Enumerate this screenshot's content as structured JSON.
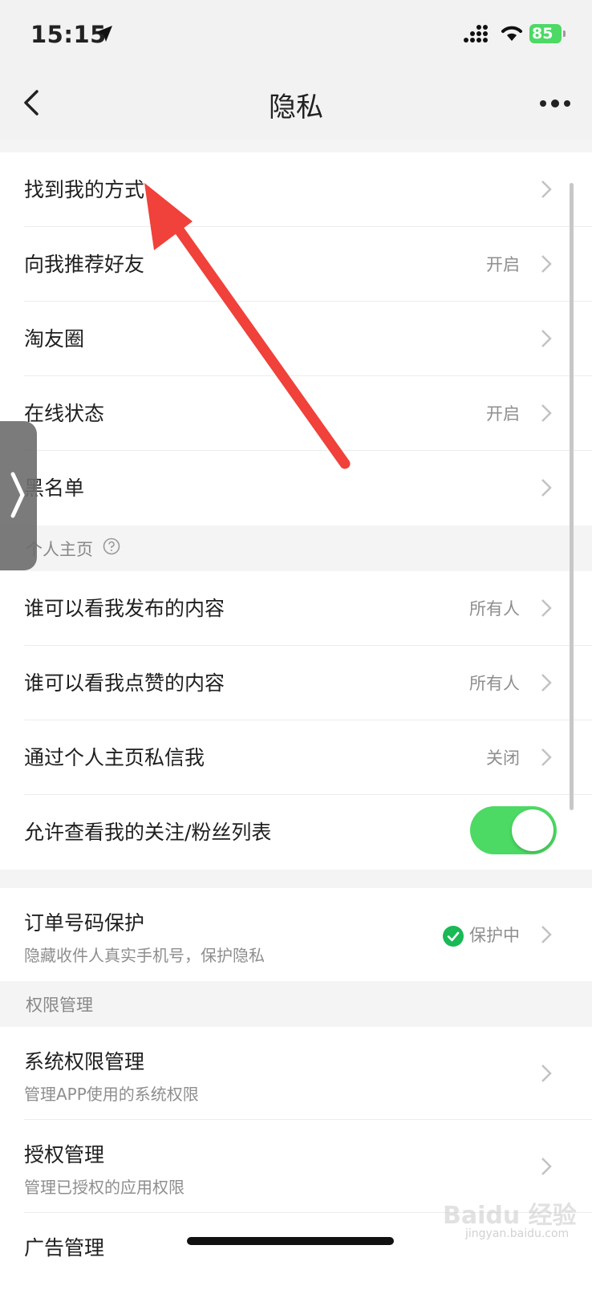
{
  "status": {
    "time": "15:15",
    "battery": "85"
  },
  "nav": {
    "title": "隐私"
  },
  "rows_top": [
    {
      "label": "找到我的方式",
      "value": ""
    },
    {
      "label": "向我推荐好友",
      "value": "开启"
    },
    {
      "label": "淘友圈",
      "value": ""
    },
    {
      "label": "在线状态",
      "value": "开启"
    },
    {
      "label": "黑名单",
      "value": ""
    }
  ],
  "section_profile": {
    "label": "个人主页"
  },
  "rows_profile": [
    {
      "label": "谁可以看我发布的内容",
      "value": "所有人"
    },
    {
      "label": "谁可以看我点赞的内容",
      "value": "所有人"
    },
    {
      "label": "通过个人主页私信我",
      "value": "关闭"
    },
    {
      "label": "允许查看我的关注/粉丝列表",
      "toggle_on": true
    }
  ],
  "order_protection": {
    "label": "订单号码保护",
    "sub": "隐藏收件人真实手机号，保护隐私",
    "value": "保护中"
  },
  "section_permission": {
    "label": "权限管理"
  },
  "rows_permission": [
    {
      "label": "系统权限管理",
      "sub": "管理APP使用的系统权限"
    },
    {
      "label": "授权管理",
      "sub": "管理已授权的应用权限"
    },
    {
      "label": "广告管理"
    }
  ],
  "watermark": {
    "text": "Baidu 经验",
    "sub": "jingyan.baidu.com"
  },
  "colors": {
    "accent_green": "#4cd964",
    "arrow_red": "#f0413a"
  }
}
